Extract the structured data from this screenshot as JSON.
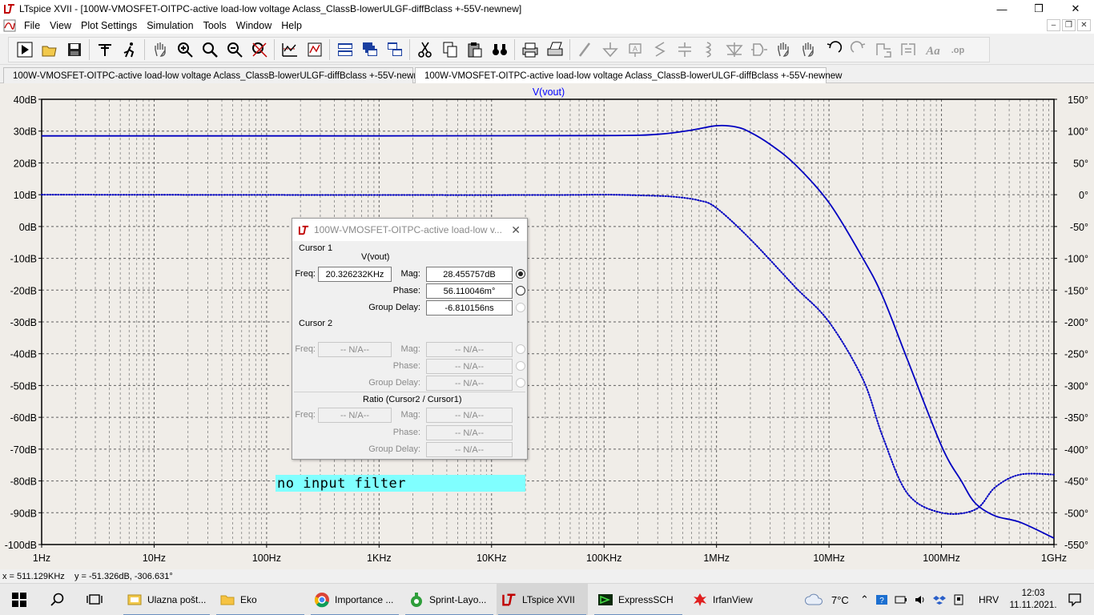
{
  "window": {
    "title": "LTspice XVII - [100W-VMOSFET-OITPC-active load-low voltage Aclass_ClassB-lowerULGF-diffBclass +-55V-newnew]",
    "minimize_label": "—",
    "maximize_label": "❒",
    "close_label": "✕"
  },
  "menu": {
    "items": [
      "File",
      "View",
      "Plot Settings",
      "Simulation",
      "Tools",
      "Window",
      "Help"
    ],
    "mdi_minimize": "–",
    "mdi_restore": "❒",
    "mdi_close": "✕"
  },
  "toolbar": {
    "icons": [
      "run-icon",
      "open-icon",
      "save-icon",
      "control-panel-icon",
      "run-halt-icon",
      "pan-icon",
      "zoom-in-icon",
      "zoom-box-icon",
      "zoom-out-icon",
      "zoom-fit-icon",
      "autorange-icon",
      "mark-icon",
      "tile-horizontal-icon",
      "cascade-icon",
      "tile-vertical-icon",
      "cut-icon",
      "copy-icon",
      "paste-icon",
      "find-icon",
      "print-icon",
      "print-setup-icon",
      "wire-icon",
      "ground-icon",
      "label-icon",
      "resistor-icon",
      "capacitor-icon",
      "inductor-icon",
      "diode-icon",
      "component-icon",
      "move-icon",
      "drag-icon",
      "undo-icon",
      "redo-icon",
      "rotate-icon",
      "mirror-icon",
      "text-icon",
      "spice-directive-icon"
    ]
  },
  "tabs": [
    {
      "label": "100W-VMOSFET-OITPC-active load-low voltage Aclass_ClassB-lowerULGF-diffBclass +-55V-newnew",
      "icon": "schematic-icon"
    },
    {
      "label": "100W-VMOSFET-OITPC-active load-low voltage Aclass_ClassB-lowerULGF-diffBclass +-55V-newnew",
      "icon": "waveform-icon"
    }
  ],
  "plot": {
    "trace_label": "V(vout)",
    "trace_color": "#0000c0",
    "label_color": "#0000ff",
    "background": "#f0ede8"
  },
  "chart_data": {
    "type": "line",
    "title": "",
    "xlabel": "",
    "ylabel": "",
    "x_scale": "log",
    "x_range_hz": [
      1,
      1000000000
    ],
    "x_ticks": [
      "1Hz",
      "10Hz",
      "100Hz",
      "1KHz",
      "10KHz",
      "100KHz",
      "1MHz",
      "10MHz",
      "100MHz",
      "1GHz"
    ],
    "y_left_range_db": [
      -100,
      40
    ],
    "y_left_ticks": [
      "40dB",
      "30dB",
      "20dB",
      "10dB",
      "0dB",
      "-10dB",
      "-20dB",
      "-30dB",
      "-40dB",
      "-50dB",
      "-60dB",
      "-70dB",
      "-80dB",
      "-90dB",
      "-100dB"
    ],
    "y_right_range_deg": [
      -550,
      150
    ],
    "y_right_ticks": [
      "150°",
      "100°",
      "50°",
      "0°",
      "-50°",
      "-100°",
      "-150°",
      "-200°",
      "-250°",
      "-300°",
      "-350°",
      "-400°",
      "-450°",
      "-500°",
      "-550°"
    ],
    "grid": true,
    "series": [
      {
        "name": "V(vout)",
        "axis": "left",
        "style": "solid",
        "x": [
          1,
          1000,
          100000,
          300000,
          600000,
          1000000,
          1500000,
          2000000,
          3000000,
          5000000,
          10000000,
          20000000,
          30000000,
          50000000,
          100000000,
          150000000,
          200000000,
          300000000,
          500000000,
          1000000000
        ],
        "y": [
          28.5,
          28.5,
          28.6,
          29.0,
          30.3,
          31.7,
          31.3,
          29.6,
          25.8,
          19.5,
          7.5,
          -10,
          -22,
          -42,
          -69,
          -80,
          -87,
          -91,
          -93,
          -98
        ]
      },
      {
        "name": "V(vout)",
        "axis": "right",
        "style": "dotted",
        "x": [
          1,
          1000,
          30000,
          100000,
          200000,
          400000,
          700000,
          1000000,
          2000000,
          5000000,
          10000000,
          20000000,
          30000000,
          50000000,
          100000000,
          200000000,
          300000000,
          500000000,
          1000000000
        ],
        "y": [
          0,
          -0.5,
          -0.5,
          0,
          -1,
          -3,
          -9,
          -21,
          -70,
          -145,
          -200,
          -290,
          -380,
          -470,
          -500,
          -495,
          -460,
          -440,
          -440
        ]
      }
    ]
  },
  "cursor_window": {
    "title": "100W-VMOSFET-OITPC-active load-low v...",
    "close_label": "✕",
    "cursor1": {
      "header": "Cursor 1",
      "trace": "V(vout)",
      "freq_label": "Freq:",
      "freq": "20.326232KHz",
      "mag_label": "Mag:",
      "mag": "28.455757dB",
      "phase_label": "Phase:",
      "phase": "56.110046m°",
      "gd_label": "Group Delay:",
      "gd": "-6.810156ns"
    },
    "cursor2": {
      "header": "Cursor 2",
      "freq_label": "Freq:",
      "freq": "-- N/A--",
      "mag_label": "Mag:",
      "mag": "-- N/A--",
      "phase_label": "Phase:",
      "phase": "-- N/A--",
      "gd_label": "Group Delay:",
      "gd": "-- N/A--"
    },
    "ratio": {
      "header": "Ratio (Cursor2 / Cursor1)",
      "freq_label": "Freq:",
      "freq": "-- N/A--",
      "mag_label": "Mag:",
      "mag": "-- N/A--",
      "phase_label": "Phase:",
      "phase": "-- N/A--",
      "gd_label": "Group Delay:",
      "gd": "-- N/A--"
    }
  },
  "annotation": {
    "text": "no input filter",
    "color": "#80ffff"
  },
  "statusbar": {
    "text": "x = 511.129KHz    y = -51.326dB, -306.631°"
  },
  "taskbar": {
    "apps": [
      {
        "label": "Ulazna pošt...",
        "icon": "mail-folder-icon"
      },
      {
        "label": "Eko",
        "icon": "folder-icon"
      },
      {
        "label": "Importance ...",
        "icon": "chrome-icon"
      },
      {
        "label": "Sprint-Layo...",
        "icon": "sprint-layout-icon"
      },
      {
        "label": "LTspice XVII",
        "icon": "ltspice-icon"
      },
      {
        "label": "ExpressSCH",
        "icon": "expresssch-icon"
      },
      {
        "label": "IrfanView",
        "icon": "irfanview-icon"
      }
    ],
    "weather": "7°C",
    "language": "HRV",
    "time": "12:03",
    "date": "11.11.2021."
  }
}
